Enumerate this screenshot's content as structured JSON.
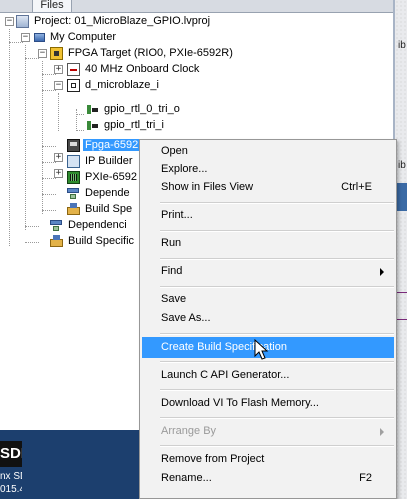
{
  "tab": {
    "label": "Files"
  },
  "tree": {
    "project": "Project: 01_MicroBlaze_GPIO.lvproj",
    "my_computer": "My Computer",
    "fpga_target": "FPGA Target (RIO0, PXIe-6592R)",
    "clock": "40 MHz Onboard Clock",
    "microblaze": "d_microblaze_i",
    "gpio_out": "gpio_rtl_0_tri_o",
    "gpio_in": "gpio_rtl_tri_i",
    "fpga_vi": "Fpga-6592",
    "ip_builder": "IP Builder",
    "pxie": "PXIe-6592",
    "fpga_deps": "Depende",
    "fpga_build": "Build Spe",
    "deps": "Dependenci",
    "build": "Build Specific"
  },
  "desktop_icon": {
    "logo": "SDK",
    "line1": "nx SDK",
    "line2": "015.4"
  },
  "right_snippets": [
    "ib",
    "ib"
  ],
  "menu": {
    "items": [
      {
        "label": "Open"
      },
      {
        "label": "Explore..."
      },
      {
        "label": "Show in Files View",
        "shortcut": "Ctrl+E"
      },
      {
        "label": "Print..."
      },
      {
        "label": "Run"
      },
      {
        "label": "Find",
        "submenu": true
      },
      {
        "label": "Save"
      },
      {
        "label": "Save As..."
      },
      {
        "label": "Create Build Specification",
        "highlighted": true
      },
      {
        "label": "Launch C API Generator..."
      },
      {
        "label": "Download VI To Flash Memory..."
      },
      {
        "label": "Arrange By",
        "submenu": true,
        "disabled": true
      },
      {
        "label": "Remove from Project"
      },
      {
        "label": "Rename...",
        "shortcut": "F2"
      }
    ]
  }
}
